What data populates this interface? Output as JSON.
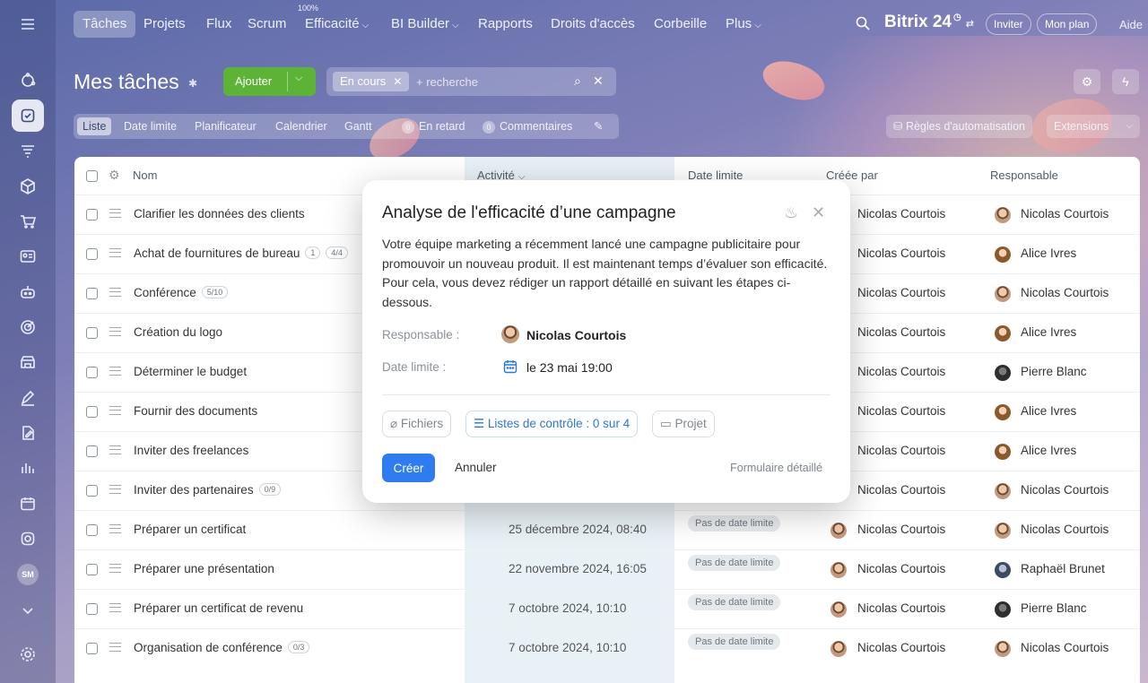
{
  "topnav": {
    "items": [
      "Tâches",
      "Projets",
      "Flux",
      "Scrum",
      "Efficacité",
      "BI Builder",
      "Rapports",
      "Droits d'accès",
      "Corbeille",
      "Plus"
    ],
    "efficacite_badge": "100%",
    "brand": "Bitrix 24",
    "invite": "Inviter",
    "plan": "Mon plan",
    "help": "Aide"
  },
  "page": {
    "title": "Mes tâches",
    "add_label": "Ajouter",
    "filter_chip": "En cours",
    "search_placeholder": "+ recherche"
  },
  "viewbar": {
    "tabs": [
      "Liste",
      "Date limite",
      "Planificateur",
      "Calendrier",
      "Gantt"
    ],
    "late_count": "0",
    "late_label": "En retard",
    "comments_count": "0",
    "comments_label": "Commentaires",
    "automation": "Règles d'automatisation",
    "extensions": "Extensions"
  },
  "table": {
    "headers": {
      "name": "Nom",
      "activity": "Activité",
      "deadline": "Date limite",
      "created_by": "Créée par",
      "responsible": "Responsable"
    },
    "rows": [
      {
        "name": "Clarifier les données des clients",
        "tag": "",
        "activity": "",
        "deadline": "",
        "creator": "Nicolas Courtois",
        "resp": "Nicolas Courtois",
        "ra": "av-nc"
      },
      {
        "name": "Achat de fournitures de bureau",
        "tag": "1",
        "tag2": "4/4",
        "activity": "",
        "deadline": "",
        "creator": "Nicolas Courtois",
        "resp": "Alice Ivres",
        "ra": "av-ai"
      },
      {
        "name": "Conférence",
        "tag": "5/10",
        "activity": "",
        "deadline": "",
        "creator": "Nicolas Courtois",
        "resp": "Nicolas Courtois",
        "ra": "av-nc"
      },
      {
        "name": "Création du logo",
        "tag": "",
        "activity": "",
        "deadline": "",
        "creator": "Nicolas Courtois",
        "resp": "Alice Ivres",
        "ra": "av-ai"
      },
      {
        "name": "Déterminer le budget",
        "tag": "",
        "activity": "",
        "deadline": "",
        "creator": "Nicolas Courtois",
        "resp": "Pierre Blanc",
        "ra": "av-pb"
      },
      {
        "name": "Fournir des documents",
        "tag": "",
        "activity": "",
        "deadline": "",
        "creator": "Nicolas Courtois",
        "resp": "Alice Ivres",
        "ra": "av-ai"
      },
      {
        "name": "Inviter des freelances",
        "tag": "",
        "activity": "",
        "deadline": "",
        "creator": "Nicolas Courtois",
        "resp": "Alice Ivres",
        "ra": "av-ai"
      },
      {
        "name": "Inviter des partenaires",
        "tag": "0/9",
        "activity": "",
        "deadline": "",
        "creator": "Nicolas Courtois",
        "resp": "Nicolas Courtois",
        "ra": "av-nc"
      },
      {
        "name": "Préparer un certificat",
        "tag": "",
        "activity": "25 décembre 2024, 08:40",
        "deadline": "Pas de date limite",
        "creator": "Nicolas Courtois",
        "resp": "Nicolas Courtois",
        "ra": "av-nc"
      },
      {
        "name": "Préparer une présentation",
        "tag": "",
        "activity": "22 novembre 2024, 16:05",
        "deadline": "Pas de date limite",
        "creator": "Nicolas Courtois",
        "resp": "Raphaël Brunet",
        "ra": "av-rb"
      },
      {
        "name": "Préparer un certificat de revenu",
        "tag": "",
        "activity": "7 octobre 2024, 10:10",
        "deadline": "Pas de date limite",
        "creator": "Nicolas Courtois",
        "resp": "Pierre Blanc",
        "ra": "av-pb"
      },
      {
        "name": "Organisation de conférence",
        "tag": "0/3",
        "activity": "7 octobre 2024, 10:10",
        "deadline": "Pas de date limite",
        "creator": "Nicolas Courtois",
        "resp": "Nicolas Courtois",
        "ra": "av-nc"
      }
    ]
  },
  "modal": {
    "title": "Analyse de l'efficacité d’une campagne",
    "description": "Votre équipe marketing a récemment lancé une campagne publicitaire pour promouvoir un nouveau produit. Il est maintenant temps d’évaluer son efficacité. Pour cela, vous devez rédiger un rapport détaillé en suivant les étapes ci-dessous.",
    "responsible_label": "Responsable :",
    "responsible_value": "Nicolas Courtois",
    "deadline_label": "Date limite :",
    "deadline_value": "le 23 mai 19:00",
    "files": "Fichiers",
    "checklists": "Listes de contrôle : 0 sur 4",
    "project": "Projet",
    "create": "Créer",
    "cancel": "Annuler",
    "detailed_form": "Formulaire détaillé"
  },
  "rail": {
    "avatar_initials": "SM"
  },
  "colors": {
    "primary": "#2f7cf0",
    "add_green": "#5cb335",
    "activity_bg": "#e8f2f6"
  }
}
